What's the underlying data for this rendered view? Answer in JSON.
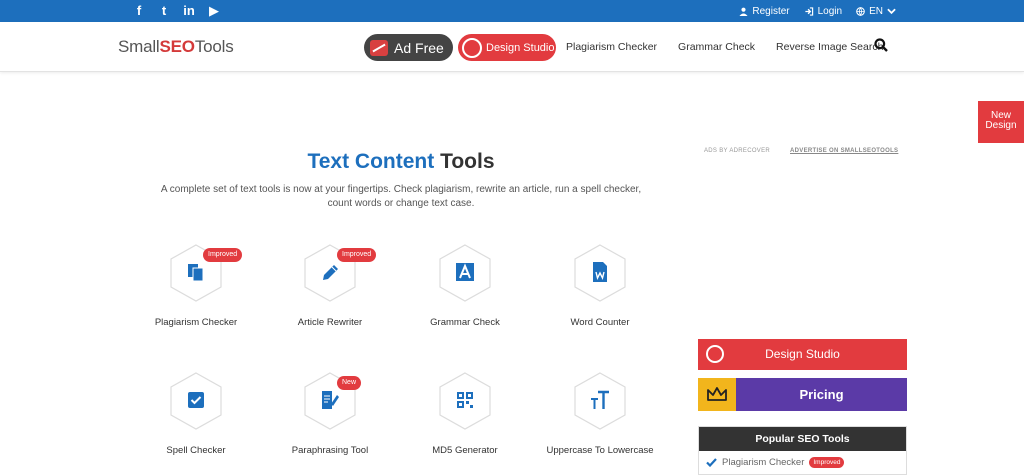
{
  "topbar": {
    "social": [
      {
        "icon": "facebook-icon",
        "glyph": "f"
      },
      {
        "icon": "twitter-icon",
        "glyph": "t"
      },
      {
        "icon": "linkedin-icon",
        "glyph": "in"
      },
      {
        "icon": "youtube-icon",
        "glyph": "▶"
      }
    ],
    "register_label": "Register",
    "login_label": "Login",
    "language_label": "EN"
  },
  "nav": {
    "logo_small": "Small",
    "logo_seo": "SEO",
    "logo_tools": "Tools",
    "ad_free_label": "Ad Free",
    "design_studio_label": "Design Studio",
    "links": [
      "Plagiarism Checker",
      "Grammar Check",
      "Reverse Image Search"
    ]
  },
  "new_design_label": [
    "New",
    "Design"
  ],
  "heading": {
    "part1": "Text Content",
    "part2": "Tools",
    "subtitle_line1": "A complete set of text tools is now at your fingertips. Check plagiarism, rewrite an article, run a spell checker,",
    "subtitle_line2": "count words or change text case."
  },
  "ads": {
    "ads_by": "ADS BY ADRECOVER",
    "advertise": "ADVERTISE ON SMALLSEOTOOLS"
  },
  "tools": [
    {
      "label": "Plagiarism Checker",
      "badge": "Improved",
      "icon": "documents-icon"
    },
    {
      "label": "Article Rewriter",
      "badge": "Improved",
      "icon": "pencil-icon"
    },
    {
      "label": "Grammar Check",
      "badge": "",
      "icon": "letter-a-icon"
    },
    {
      "label": "Word Counter",
      "badge": "",
      "icon": "word-document-icon"
    },
    {
      "label": "Spell Checker",
      "badge": "",
      "icon": "checkbox-icon"
    },
    {
      "label": "Paraphrasing Tool",
      "badge": "New",
      "icon": "edit-document-icon"
    },
    {
      "label": "MD5 Generator",
      "badge": "",
      "icon": "qr-code-icon"
    },
    {
      "label": "Uppercase To Lowercase",
      "badge": "",
      "icon": "text-case-icon"
    }
  ],
  "sidebar": {
    "design_studio_label": "Design Studio",
    "pricing_label": "Pricing",
    "popular_title": "Popular SEO Tools",
    "popular_items": [
      {
        "label": "Plagiarism Checker",
        "badge": "Improved"
      }
    ]
  },
  "colors": {
    "brand_blue": "#1d6fbd",
    "accent_red": "#e23b3f",
    "pricing_purple": "#5b3aa7",
    "crown_yellow": "#f2b51c"
  }
}
